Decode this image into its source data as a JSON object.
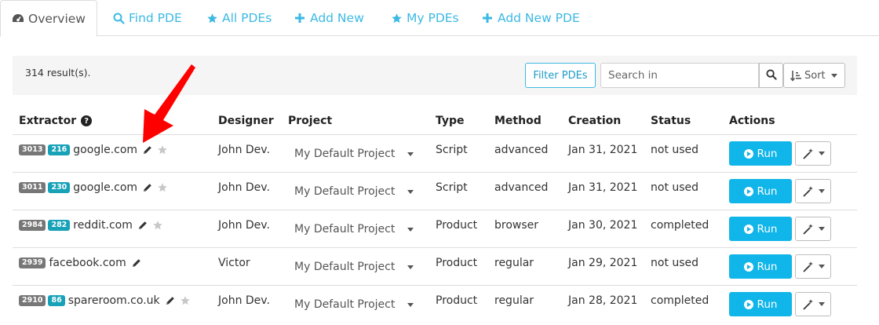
{
  "tabs": [
    {
      "label": "Overview",
      "icon": "dashboard-icon",
      "active": true
    },
    {
      "label": "Find PDE",
      "icon": "search-icon"
    },
    {
      "label": "All PDEs",
      "icon": "star-icon"
    },
    {
      "label": "Add New",
      "icon": "plus-icon"
    },
    {
      "label": "My PDEs",
      "icon": "star-icon"
    },
    {
      "label": "Add New PDE",
      "icon": "plus-icon"
    }
  ],
  "toolbar": {
    "results": "314 result(s).",
    "filter_label": "Filter PDEs",
    "search_placeholder": "Search in",
    "sort_label": "Sort"
  },
  "table": {
    "headers": {
      "extractor": "Extractor",
      "designer": "Designer",
      "project": "Project",
      "type": "Type",
      "method": "Method",
      "creation": "Creation",
      "status": "Status",
      "actions": "Actions"
    },
    "rows": [
      {
        "id": "3013",
        "version": "216",
        "domain": "google.com",
        "designer": "John Dev.",
        "project": "My Default Project",
        "type": "Script",
        "method": "advanced",
        "creation": "Jan 31, 2021",
        "status": "not used",
        "run": "Run"
      },
      {
        "id": "3011",
        "version": "230",
        "domain": "google.com",
        "designer": "John Dev.",
        "project": "My Default Project",
        "type": "Script",
        "method": "advanced",
        "creation": "Jan 31, 2021",
        "status": "not used",
        "run": "Run"
      },
      {
        "id": "2984",
        "version": "282",
        "domain": "reddit.com",
        "designer": "John Dev.",
        "project": "My Default Project",
        "type": "Product",
        "method": "browser",
        "creation": "Jan 30, 2021",
        "status": "completed",
        "run": "Run"
      },
      {
        "id": "2939",
        "version": null,
        "domain": "facebook.com",
        "designer": "Victor",
        "project": "My Default Project",
        "type": "Product",
        "method": "regular",
        "creation": "Jan 29, 2021",
        "status": "not used",
        "run": "Run"
      },
      {
        "id": "2910",
        "version": "86",
        "domain": "spareroom.co.uk",
        "designer": "John Dev.",
        "project": "My Default Project",
        "type": "Product",
        "method": "regular",
        "creation": "Jan 28, 2021",
        "status": "completed",
        "run": "Run"
      }
    ]
  },
  "colors": {
    "accent": "#3cb9e3",
    "run_button": "#10b5e9",
    "badge_gray": "#777777",
    "badge_teal": "#17a2b8",
    "annotation_arrow": "#ff0000"
  }
}
